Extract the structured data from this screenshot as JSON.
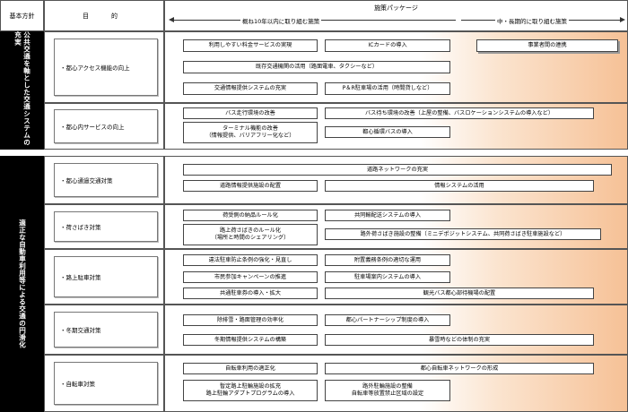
{
  "header": {
    "basic_policy": "基本方針",
    "purpose": "目　的",
    "package_title": "施策パッケージ",
    "short_term": "概ね10年以内に取り組む施策",
    "long_term": "中・長期的に取り組む施策"
  },
  "sections": [
    {
      "label": "公共交通を軸とした交通システムの充実",
      "purposes": [
        {
          "label": "・都心アクセス機能の向上",
          "measures": [
            {
              "id": "m1",
              "text": "利用しやすい料金サービスの実現"
            },
            {
              "id": "m2",
              "text": "ICカードの導入"
            },
            {
              "id": "m3",
              "text": "事業者間の連携"
            },
            {
              "id": "m4",
              "text": "既存交通機関の活用（路面電車、タクシーなど）"
            },
            {
              "id": "m5",
              "text": "交通情報提供システムの充実"
            },
            {
              "id": "m6",
              "text": "P＆R駐車場の活用（時間貸しなど）"
            }
          ]
        },
        {
          "label": "・都心内サービスの向上",
          "measures": [
            {
              "id": "m7",
              "text": "バス走行環境の改善"
            },
            {
              "id": "m8",
              "text": "バス待ち環境の改善（上屋の整備、バスロケーションシステムの導入など）"
            },
            {
              "id": "m9",
              "text": "ターミナル機能の改善",
              "text2": "（情報提供、バリアフリー化など）"
            },
            {
              "id": "m10",
              "text": "都心循環バスの導入"
            }
          ]
        }
      ]
    },
    {
      "label": "適正な自動車利用等による交通の円滑化",
      "purposes": [
        {
          "label": "・都心通過交通対策",
          "measures": [
            {
              "id": "m11",
              "text": "道路ネットワークの充実"
            },
            {
              "id": "m12",
              "text": "道路情報提供施設の配置"
            },
            {
              "id": "m13",
              "text": "情報システムの活用"
            }
          ]
        },
        {
          "label": "・荷さばき対策",
          "measures": [
            {
              "id": "m14",
              "text": "荷受側の納品ルール化"
            },
            {
              "id": "m15",
              "text": "共同輸配送システムの導入"
            },
            {
              "id": "m16",
              "text": "路上荷さばきのルール化",
              "text2": "（場所と時間のシェアリング）"
            },
            {
              "id": "m17",
              "text": "路外荷さばき施設の整備（ミニデポジットシステム、共同荷さばき駐車施設など）"
            }
          ]
        },
        {
          "label": "・路上駐車対策",
          "measures": [
            {
              "id": "m18",
              "text": "違法駐車防止条例の強化・見直し"
            },
            {
              "id": "m19",
              "text": "附置義務条例の適切な運用"
            },
            {
              "id": "m20",
              "text": "市民参加キャンペーンの推進"
            },
            {
              "id": "m21",
              "text": "駐車場案内システムの導入"
            },
            {
              "id": "m22",
              "text": "共通駐車券の導入・拡大"
            },
            {
              "id": "m23",
              "text": "観光バス都心部待機場の配置"
            }
          ]
        },
        {
          "label": "・冬期交通対策",
          "measures": [
            {
              "id": "m24",
              "text": "除排雪・路面管理の効率化"
            },
            {
              "id": "m25",
              "text": "都心パートナーシップ制度の導入"
            },
            {
              "id": "m26",
              "text": "冬期情報提供システムの構築"
            },
            {
              "id": "m27",
              "text": "暴雪時などの体制の充実"
            }
          ]
        },
        {
          "label": "・自転車対策",
          "measures": [
            {
              "id": "m28",
              "text": "自転車利用の適正化"
            },
            {
              "id": "m29",
              "text": "都心自転車ネットワークの形成"
            },
            {
              "id": "m30",
              "text": "暫定路上駐輪施設の拡充",
              "text2": "路上駐輪アダプトプログラムの導入"
            },
            {
              "id": "m31",
              "text": "路外駐輪施設の整備",
              "text2": "自転車等放置禁止区域の設定"
            }
          ]
        }
      ]
    }
  ]
}
